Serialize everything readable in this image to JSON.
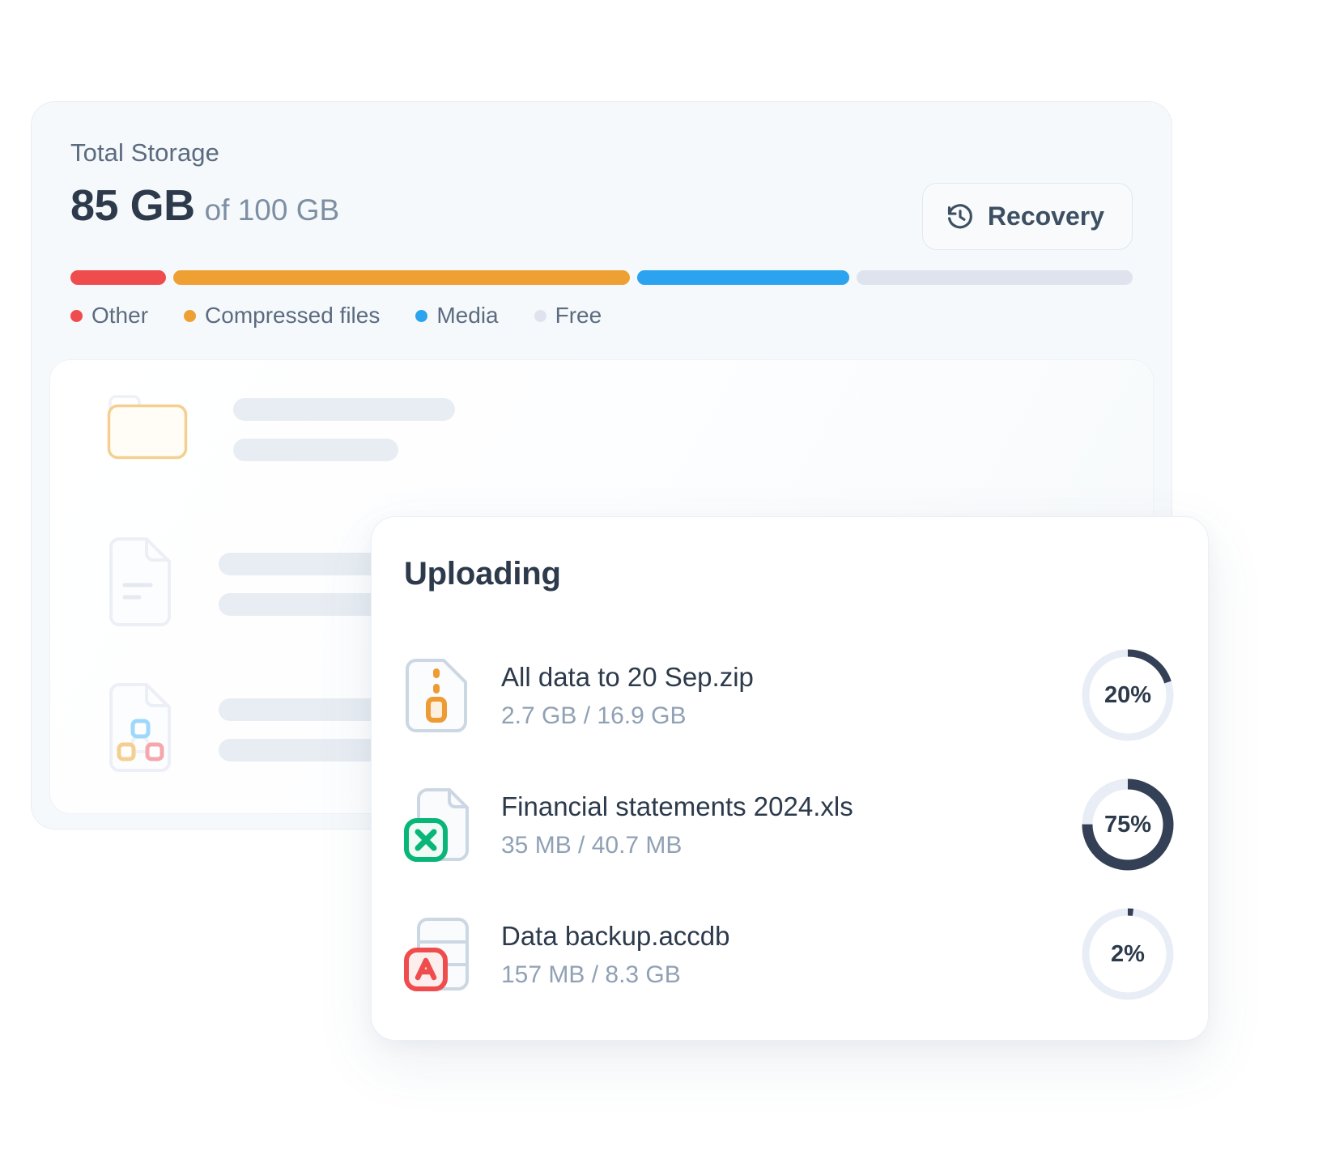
{
  "storage": {
    "title": "Total Storage",
    "used": "85 GB",
    "of_total": "of 100 GB",
    "recovery_label": "Recovery",
    "recovery_icon": "history-clock-icon",
    "segments": [
      {
        "name": "Other",
        "color": "#ef4d4d",
        "percent": 9
      },
      {
        "name": "Compressed files",
        "color": "#efa033",
        "percent": 43
      },
      {
        "name": "Media",
        "color": "#2ba3ee",
        "percent": 20
      },
      {
        "name": "Free",
        "color": "#dfe3ee",
        "percent": 26
      }
    ],
    "legend": [
      {
        "label": "Other",
        "color": "#ef4d4d"
      },
      {
        "label": "Compressed files",
        "color": "#efa033"
      },
      {
        "label": "Media",
        "color": "#2ba3ee"
      },
      {
        "label": "Free",
        "color": "#dfe3ee"
      }
    ],
    "skeleton_rows": [
      {
        "icon": "folder-icon",
        "line1_width": 274,
        "line2_width": 204
      },
      {
        "icon": "document-lines-icon",
        "line1_width": 256,
        "line2_width": 224
      },
      {
        "icon": "document-network-icon",
        "line1_width": 250,
        "line2_width": 214
      }
    ]
  },
  "uploading": {
    "title": "Uploading",
    "ring_track_color": "#e8edf6",
    "ring_fill_color": "#334055",
    "files": [
      {
        "name": "All data to 20 Sep.zip",
        "size": "2.7 GB / 16.9 GB",
        "percent": 20,
        "percent_label": "20%",
        "icon": "zip-file-icon",
        "icon_accent": "#ef9b33",
        "ring_width": 9
      },
      {
        "name": "Financial statements 2024.xls",
        "size": "35 MB / 40.7 MB",
        "percent": 75,
        "percent_label": "75%",
        "icon": "excel-file-icon",
        "icon_accent": "#08b678",
        "ring_width": 13
      },
      {
        "name": "Data backup.accdb",
        "size": "157 MB / 8.3 GB",
        "percent": 2,
        "percent_label": "2%",
        "icon": "access-file-icon",
        "icon_accent": "#ef4d4d",
        "ring_width": 9
      }
    ]
  }
}
